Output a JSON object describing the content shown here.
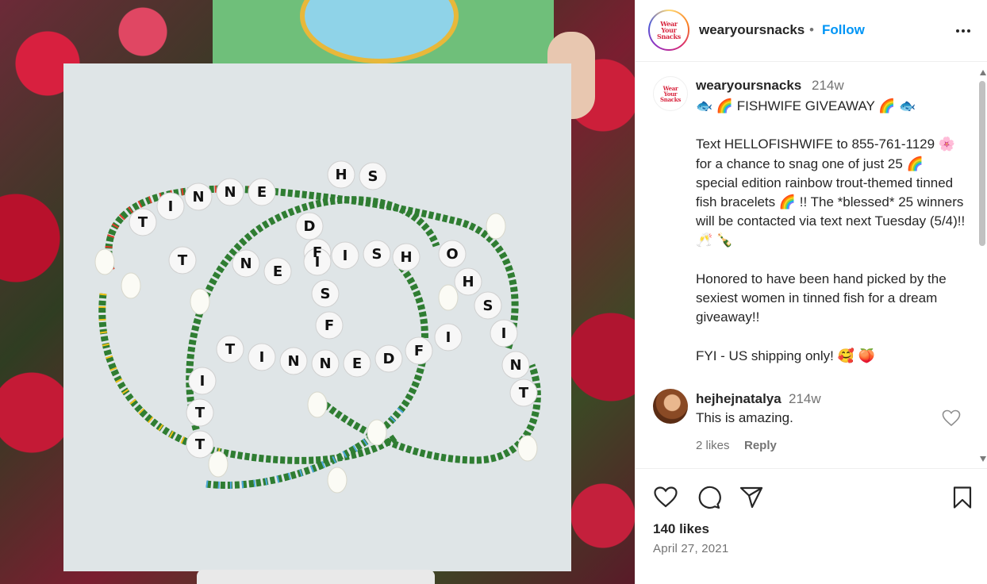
{
  "header": {
    "username": "wearyoursnacks",
    "separator": "•",
    "follow_label": "Follow",
    "avatar_logo": [
      "Wear",
      "Your",
      "Snacks"
    ]
  },
  "caption": {
    "username": "wearyoursnacks",
    "time": "214w",
    "text": "🐟 🌈 FISHWIFE GIVEAWAY 🌈 🐟\n\nText HELLOFISHWIFE to 855-761-1129 🌸 for a chance to snag one of just 25 🌈 special edition rainbow trout-themed tinned fish bracelets 🌈 !! The *blessed* 25 winners will be contacted via text next Tuesday (5/4)!! 🥂 🍾\n\nHonored to have been hand picked by the sexiest women in tinned fish for a dream giveaway!!\n\nFYI - US shipping only! 🥰 🍑"
  },
  "comment": {
    "username": "hejhejnatalya",
    "time": "214w",
    "text": "This is amazing.",
    "likes": "2 likes",
    "reply_label": "Reply"
  },
  "footer": {
    "likes": "140 likes",
    "date": "April 27, 2021"
  },
  "photo": {
    "bracelet_words": [
      "TINNED FISH",
      "TINNED FISH",
      "TINNED FISH",
      "TINNED FISH",
      "TINNED FISH"
    ]
  },
  "colors": {
    "link": "#0095f6",
    "brand_red": "#d8263f",
    "muted": "#737373",
    "text": "#262626"
  },
  "icons": [
    "heart-icon",
    "comment-icon",
    "share-icon",
    "bookmark-icon",
    "more-icon"
  ]
}
